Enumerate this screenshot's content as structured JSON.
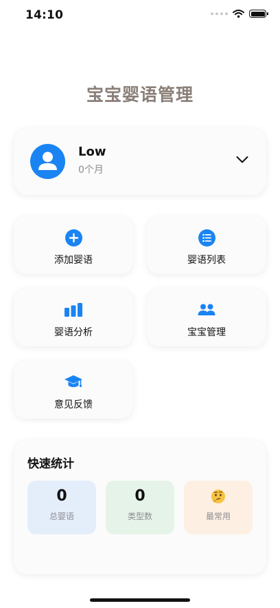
{
  "status_bar": {
    "time": "14:10"
  },
  "app": {
    "title": "宝宝婴语管理"
  },
  "profile": {
    "name": "Low",
    "age": "0个月"
  },
  "menu": [
    {
      "label": "添加婴语",
      "icon": "plus-circle-icon"
    },
    {
      "label": "婴语列表",
      "icon": "list-icon"
    },
    {
      "label": "婴语分析",
      "icon": "bar-chart-icon"
    },
    {
      "label": "宝宝管理",
      "icon": "people-icon"
    },
    {
      "label": "意见反馈",
      "icon": "graduation-cap-icon"
    }
  ],
  "stats": {
    "title": "快速统计",
    "items": [
      {
        "value": "0",
        "label": "总婴语",
        "bg": "#e4eefb"
      },
      {
        "value": "0",
        "label": "类型数",
        "bg": "#e6f3e8"
      },
      {
        "emoji": "🤔",
        "label": "最常用",
        "bg": "#fdf0e2"
      }
    ]
  },
  "colors": {
    "accent": "#1a84f3",
    "title": "#8a7f78"
  }
}
